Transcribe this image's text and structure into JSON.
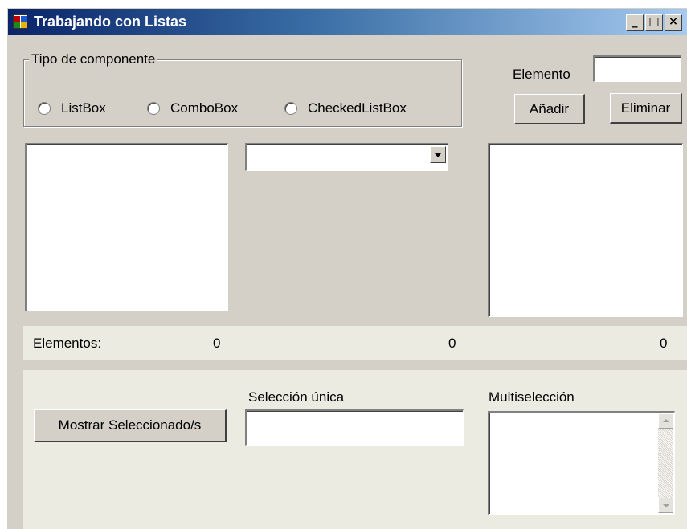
{
  "window": {
    "title": "Trabajando con Listas",
    "controls": {
      "minimize": "_",
      "maximize": "□",
      "close": "×"
    }
  },
  "component_type": {
    "title": "Tipo de componente",
    "options": [
      "ListBox",
      "ComboBox",
      "CheckedListBox"
    ]
  },
  "element_input": {
    "label": "Elemento",
    "value": "",
    "add_label": "Añadir",
    "remove_label": "Eliminar"
  },
  "counts": {
    "label": "Elementos:",
    "listbox": "0",
    "combobox": "0",
    "checkedlistbox": "0"
  },
  "selection": {
    "show_button_label": "Mostrar Seleccionado/s",
    "single_label": "Selección única",
    "single_value": "",
    "multi_label": "Multiselección"
  },
  "icons": {
    "app": "app-window-icon",
    "combo_arrow": "chevron-down-icon",
    "scroll_up": "scroll-up-icon",
    "scroll_down": "scroll-down-icon"
  },
  "colors": {
    "titlebar_start": "#0a246a",
    "titlebar_end": "#a6caf0",
    "window_face": "#d4d0c8",
    "panel_face": "#ecebe1"
  }
}
